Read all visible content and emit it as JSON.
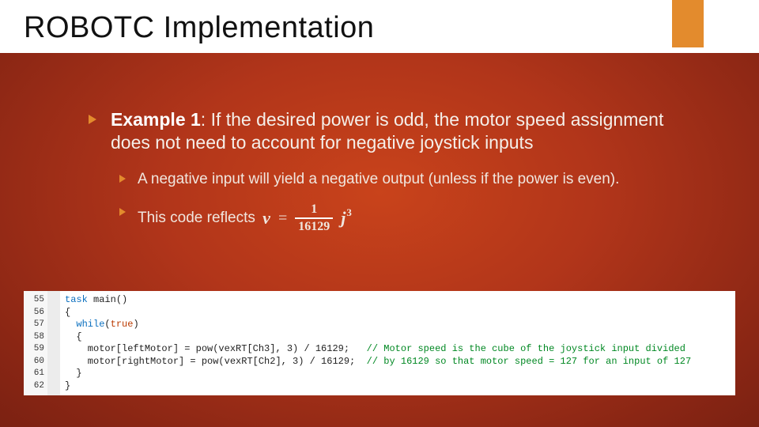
{
  "title": "ROBOTC Implementation",
  "main_bullet": {
    "label": "Example 1",
    "text": ": If the desired power is odd, the motor speed assignment does not need to account for negative joystick inputs"
  },
  "sub_bullets": [
    {
      "text": "A negative input will yield a negative output (unless if the power is even)."
    },
    {
      "text": "This code reflects "
    }
  ],
  "formula": {
    "lhs": "v",
    "num": "1",
    "den": "16129",
    "rhs_base": "j",
    "rhs_exp": "3"
  },
  "code": {
    "line_numbers": [
      "55",
      "56",
      "57",
      "58",
      "59",
      "60",
      "61",
      "62"
    ],
    "lines": [
      {
        "parts": [
          {
            "t": "task",
            "c": "kw"
          },
          {
            "t": " main()",
            "c": ""
          }
        ]
      },
      {
        "parts": [
          {
            "t": "{",
            "c": ""
          }
        ]
      },
      {
        "parts": [
          {
            "t": "  ",
            "c": ""
          },
          {
            "t": "while",
            "c": "kw"
          },
          {
            "t": "(",
            "c": ""
          },
          {
            "t": "true",
            "c": "cond"
          },
          {
            "t": ")",
            "c": ""
          }
        ]
      },
      {
        "parts": [
          {
            "t": "  {",
            "c": ""
          }
        ]
      },
      {
        "parts": [
          {
            "t": "    motor[leftMotor] = pow(vexRT[Ch3], 3) / 16129;   ",
            "c": ""
          },
          {
            "t": "// Motor speed is the cube of the joystick input divided",
            "c": "comment"
          }
        ]
      },
      {
        "parts": [
          {
            "t": "    motor[rightMotor] = pow(vexRT[Ch2], 3) / 16129;  ",
            "c": ""
          },
          {
            "t": "// by 16129 so that motor speed = 127 for an input of 127",
            "c": "comment"
          }
        ]
      },
      {
        "parts": [
          {
            "t": "  }",
            "c": ""
          }
        ]
      },
      {
        "parts": [
          {
            "t": "}",
            "c": ""
          }
        ]
      }
    ]
  }
}
